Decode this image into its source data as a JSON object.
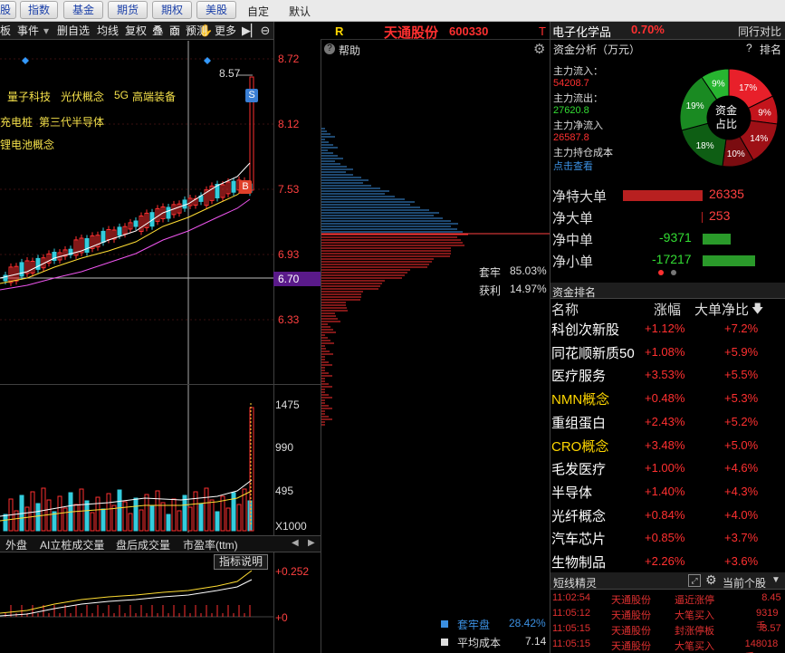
{
  "top_tabs": [
    "股",
    "指数",
    "基金",
    "期货",
    "期权",
    "美股",
    "自定",
    "默认"
  ],
  "toolbar": {
    "items": [
      "板",
      "事件",
      "删自选",
      "均线",
      "复权",
      "叠",
      "面",
      "预测",
      "更多"
    ],
    "icons": [
      "edit-icon",
      "save-icon",
      "lock-icon",
      "hand-icon",
      "zoom-in-icon",
      "zoom-out-icon"
    ]
  },
  "concepts": [
    "量子科技",
    "光伏概念",
    "5G",
    "高端装备",
    "充电桩",
    "第三代半导体",
    "锂电池概念"
  ],
  "price_axis": [
    "8.72",
    "8.12",
    "7.53",
    "6.93",
    "6.70",
    "6.33"
  ],
  "price_marks": {
    "high_label": "8.57",
    "sell_badge": "S",
    "buy_badge": "B"
  },
  "volume_axis": [
    "1475",
    "990",
    "495",
    "X1000"
  ],
  "bottom_tabs": [
    "外盘",
    "AI立桩成交量",
    "盘后成交量",
    "市盈率(ttm)"
  ],
  "indicator": {
    "button": "指标说明",
    "top": "+0.252",
    "zero": "+0"
  },
  "stock": {
    "r": "R",
    "name": "天通股份",
    "code": "600330",
    "t": "T",
    "help": "帮助"
  },
  "chip": {
    "trapped_label": "套牢",
    "trapped_pct": "85.03%",
    "profit_label": "获利",
    "profit_pct": "14.97%",
    "trap_disk_label": "套牢盘",
    "trap_disk_pct": "28.42%",
    "avg_cost_label": "平均成本",
    "avg_cost": "7.14"
  },
  "sector": {
    "name": "电子化学品",
    "pct": "0.70%",
    "peer_label": "同行对比"
  },
  "fund_analysis": {
    "title": "资金分析（万元）",
    "help": "?",
    "rank_label": "排名",
    "inflow_label": "主力流入：",
    "inflow": "54208.7",
    "outflow_label": "主力流出：",
    "outflow": "27620.8",
    "net_label": "主力净流入",
    "net": "26587.8",
    "cost_label": "主力持仓成本",
    "view_link": "点击查看",
    "donut_center": "资金\n占比",
    "donut_center_1": "资金",
    "donut_center_2": "占比",
    "slices": [
      {
        "label": "17%",
        "value": 17,
        "color": "#e8202a"
      },
      {
        "label": "9%",
        "value": 9,
        "color": "#c4141c"
      },
      {
        "label": "14%",
        "value": 14,
        "color": "#9e1016"
      },
      {
        "label": "10%",
        "value": 10,
        "color": "#7a0c10"
      },
      {
        "label": "18%",
        "value": 18,
        "color": "#0e5e14"
      },
      {
        "label": "19%",
        "value": 19,
        "color": "#1a8a22"
      },
      {
        "label": "9%",
        "value": 9,
        "color": "#27b530"
      }
    ]
  },
  "net_flows": [
    {
      "label": "净特大单",
      "value": "26335",
      "amount": 26335
    },
    {
      "label": "净大单",
      "value": "253",
      "amount": 253
    },
    {
      "label": "净中单",
      "value": "-9371",
      "amount": -9371
    },
    {
      "label": "净小单",
      "value": "-17217",
      "amount": -17217
    }
  ],
  "ranking": {
    "title": "资金排名",
    "headers": [
      "名称",
      "涨幅",
      "大单净比"
    ],
    "rows": [
      {
        "name": "科创次新股",
        "chg": "+1.12%",
        "ratio": "+7.2%"
      },
      {
        "name": "同花顺新质50",
        "chg": "+1.08%",
        "ratio": "+5.9%"
      },
      {
        "name": "医疗服务",
        "chg": "+3.53%",
        "ratio": "+5.5%"
      },
      {
        "name": "NMN概念",
        "chg": "+0.48%",
        "ratio": "+5.3%"
      },
      {
        "name": "重组蛋白",
        "chg": "+2.43%",
        "ratio": "+5.2%"
      },
      {
        "name": "CRO概念",
        "chg": "+3.48%",
        "ratio": "+5.0%"
      },
      {
        "name": "毛发医疗",
        "chg": "+1.00%",
        "ratio": "+4.6%"
      },
      {
        "name": "半导体",
        "chg": "+1.40%",
        "ratio": "+4.3%"
      },
      {
        "name": "光纤概念",
        "chg": "+0.84%",
        "ratio": "+4.0%"
      },
      {
        "name": "汽车芯片",
        "chg": "+0.85%",
        "ratio": "+3.7%"
      },
      {
        "name": "生物制品",
        "chg": "+2.26%",
        "ratio": "+3.6%"
      }
    ]
  },
  "news": {
    "title": "短线精灵",
    "scope": "当前个股",
    "rows": [
      {
        "time": "11:02:54",
        "stock": "天通股份",
        "event": "逼近涨停",
        "val": "8.45"
      },
      {
        "time": "11:05:12",
        "stock": "天通股份",
        "event": "大笔买入",
        "val": "9319手"
      },
      {
        "time": "11:05:15",
        "stock": "天通股份",
        "event": "封涨停板",
        "val": "8.57"
      },
      {
        "time": "11:05:15",
        "stock": "天通股份",
        "event": "大笔买入",
        "val": "148018手"
      }
    ]
  },
  "colors": {
    "up": "#ff3232",
    "down": "#33ccdd",
    "accent": "#ffd700"
  }
}
